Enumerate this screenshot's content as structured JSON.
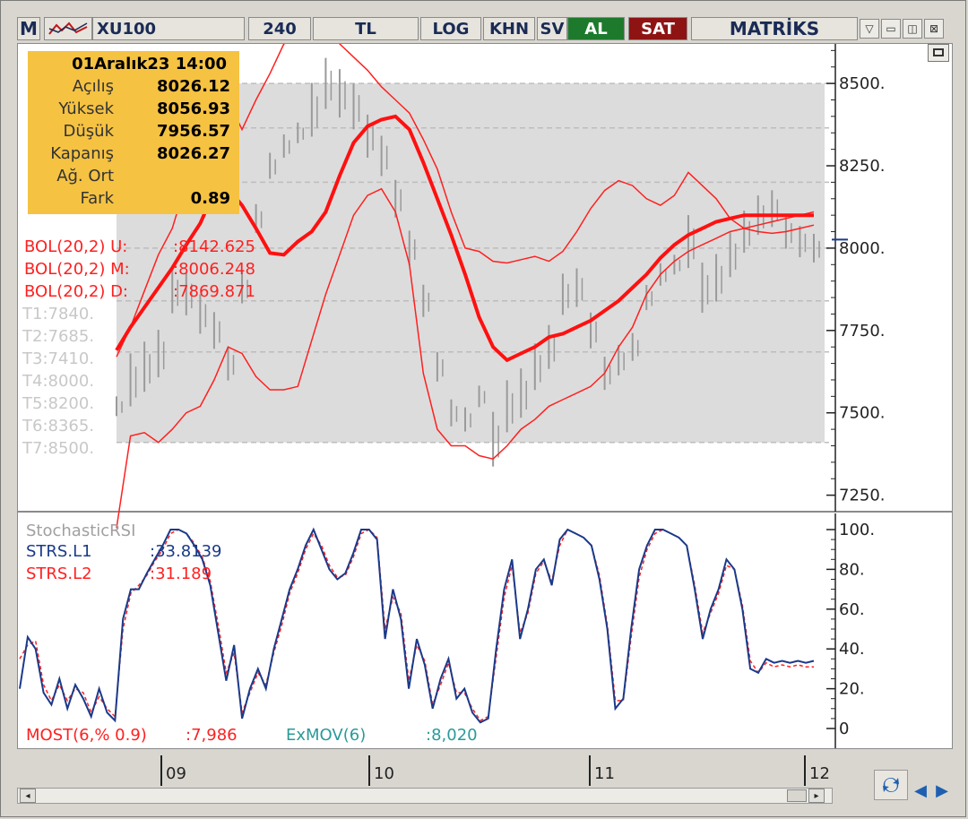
{
  "toolbar": {
    "logo": "M",
    "symbol": "XU100",
    "period": "240",
    "currency": "TL",
    "log": "LOG",
    "khn": "KHN",
    "sv": "SV",
    "buy": "AL",
    "sell": "SAT",
    "brand": "MATRİKS"
  },
  "window_buttons": [
    "▽",
    "▭",
    "◫",
    "⊠"
  ],
  "infobox": {
    "date": "01Aralık23 14:00",
    "rows": [
      {
        "label": "Açılış",
        "value": "8026.12"
      },
      {
        "label": "Yüksek",
        "value": "8056.93"
      },
      {
        "label": "Düşük",
        "value": "7956.57"
      },
      {
        "label": "Kapanış",
        "value": "8026.27"
      },
      {
        "label": "Ağ. Ort",
        "value": ""
      },
      {
        "label": "Fark",
        "value": "0.89"
      }
    ]
  },
  "price_legend": {
    "upper": {
      "label": "BOL(20,2) U:",
      "value": ":8142.625"
    },
    "middle": {
      "label": "BOL(20,2) M:",
      "value": ":8006.248"
    },
    "lower": {
      "label": "BOL(20,2) D:",
      "value": ":7869.871"
    },
    "targets": [
      "T1:7840.",
      "T2:7685.",
      "T3:7410.",
      "T4:8000.",
      "T5:8200.",
      "T6:8365.",
      "T7:8500."
    ]
  },
  "osc_legend": {
    "title": "StochasticRSI",
    "l1": {
      "label": "STRS.L1",
      "value": ":33.8139"
    },
    "l2": {
      "label": "STRS.L2",
      "value": ":31.189"
    },
    "most": {
      "label": "MOST(6,% 0.9)",
      "value": ":7,986"
    },
    "exmov": {
      "label": "ExMOV(6)",
      "value": ":8,020"
    }
  },
  "colors": {
    "bollinger": "#ff2020",
    "middle_band": "#ff1010",
    "candles": "#9a9a9a",
    "band_fill": "#dcdcdc",
    "l1": "#1a3a8a",
    "l2": "#ff2020",
    "exmov": "#2a9a9a",
    "info_bg": "#f5c242",
    "target_text": "#c8c8c8"
  },
  "chart_data": [
    {
      "type": "line",
      "title": "",
      "ylim": [
        7200,
        8620
      ],
      "y_ticks": [
        "8500.",
        "8250.",
        "8000.",
        "7750.",
        "7500.",
        "7250."
      ],
      "y_tick_values": [
        8500,
        8250,
        8000,
        7750,
        7500,
        7250
      ],
      "target_levels": [
        7840,
        7685,
        7410,
        8000,
        8200,
        8365,
        8500
      ],
      "x": [
        0,
        2,
        4,
        6,
        8,
        10,
        12,
        14,
        16,
        18,
        20,
        22,
        24,
        26,
        28,
        30,
        32,
        34,
        36,
        38,
        40,
        42,
        44,
        46,
        48,
        50,
        52,
        54,
        56,
        58,
        60,
        62,
        64,
        66,
        68,
        70,
        72,
        74,
        76,
        78,
        80,
        82,
        84,
        86,
        88,
        90,
        92,
        94,
        96,
        98,
        100
      ],
      "series": [
        {
          "name": "BOL(20,2) U",
          "values": [
            7670,
            7760,
            7870,
            7980,
            8060,
            8200,
            8330,
            8480,
            8450,
            8360,
            8450,
            8530,
            8620,
            8640,
            8680,
            8660,
            8620,
            8580,
            8540,
            8490,
            8450,
            8410,
            8330,
            8240,
            8110,
            8000,
            7990,
            7960,
            7955,
            7965,
            7975,
            7960,
            7990,
            8050,
            8120,
            8175,
            8205,
            8190,
            8150,
            8130,
            8160,
            8230,
            8190,
            8150,
            8090,
            8060,
            8050,
            8045,
            8050,
            8060,
            8070
          ]
        },
        {
          "name": "BOL(20,2) M",
          "values": [
            7690,
            7760,
            7820,
            7880,
            7940,
            8010,
            8075,
            8170,
            8180,
            8130,
            8060,
            7985,
            7980,
            8020,
            8050,
            8110,
            8220,
            8320,
            8370,
            8390,
            8400,
            8360,
            8260,
            8150,
            8040,
            7920,
            7790,
            7700,
            7660,
            7680,
            7700,
            7730,
            7740,
            7760,
            7780,
            7810,
            7840,
            7880,
            7920,
            7970,
            8010,
            8040,
            8060,
            8080,
            8090,
            8100,
            8100,
            8100,
            8100,
            8100,
            8100
          ]
        },
        {
          "name": "BOL(20,2) D",
          "values": [
            7150,
            7430,
            7440,
            7410,
            7450,
            7500,
            7520,
            7600,
            7700,
            7680,
            7610,
            7570,
            7570,
            7580,
            7720,
            7860,
            7980,
            8100,
            8160,
            8180,
            8110,
            7950,
            7620,
            7450,
            7400,
            7400,
            7370,
            7360,
            7400,
            7450,
            7480,
            7520,
            7540,
            7560,
            7580,
            7620,
            7700,
            7760,
            7860,
            7920,
            7960,
            7990,
            8010,
            8030,
            8050,
            8060,
            8070,
            8080,
            8090,
            8100,
            8110
          ]
        },
        {
          "name": "candles",
          "type": "candlestick",
          "values": [
            7520,
            7600,
            7640,
            7680,
            7870,
            7860,
            7800,
            7750,
            7650,
            7880,
            8090,
            8250,
            8310,
            8350,
            8420,
            8500,
            8470,
            8430,
            8340,
            8280,
            8150,
            8000,
            7840,
            7640,
            7500,
            7480,
            7550,
            7420,
            7520,
            7560,
            7640,
            7700,
            7860,
            7880,
            7750,
            7620,
            7660,
            7700,
            7850,
            7920,
            7950,
            8020,
            7880,
            7910,
            7980,
            8050,
            8100,
            8120,
            8050,
            8020,
            8000
          ]
        }
      ]
    },
    {
      "type": "line",
      "title": "StochasticRSI",
      "ylim": [
        0,
        100
      ],
      "y_ticks": [
        "100.",
        "80.",
        "60.",
        "40.",
        "20.",
        "0"
      ],
      "y_tick_values": [
        100,
        80,
        60,
        40,
        20,
        0
      ],
      "x_ticks": [
        "09",
        "10",
        "11",
        "12"
      ],
      "x": [
        0,
        1,
        2,
        3,
        4,
        5,
        6,
        7,
        8,
        9,
        10,
        11,
        12,
        13,
        14,
        15,
        16,
        17,
        18,
        19,
        20,
        21,
        22,
        23,
        24,
        25,
        26,
        27,
        28,
        29,
        30,
        31,
        32,
        33,
        34,
        35,
        36,
        37,
        38,
        39,
        40,
        41,
        42,
        43,
        44,
        45,
        46,
        47,
        48,
        49,
        50,
        51,
        52,
        53,
        54,
        55,
        56,
        57,
        58,
        59,
        60,
        61,
        62,
        63,
        64,
        65,
        66,
        67,
        68,
        69,
        70,
        71,
        72,
        73,
        74,
        75,
        76,
        77,
        78,
        79,
        80,
        81,
        82,
        83,
        84,
        85,
        86,
        87,
        88,
        89,
        90,
        91,
        92,
        93,
        94,
        95,
        96,
        97,
        98,
        99,
        100
      ],
      "series": [
        {
          "name": "STRS.L1",
          "values": [
            20,
            46,
            40,
            18,
            12,
            25,
            10,
            22,
            15,
            6,
            20,
            8,
            4,
            55,
            70,
            70,
            78,
            85,
            92,
            100,
            100,
            98,
            92,
            85,
            72,
            48,
            24,
            42,
            5,
            20,
            30,
            20,
            40,
            55,
            70,
            80,
            92,
            100,
            90,
            80,
            75,
            78,
            88,
            100,
            100,
            95,
            45,
            70,
            55,
            20,
            45,
            32,
            10,
            25,
            35,
            15,
            20,
            8,
            3,
            5,
            40,
            70,
            85,
            45,
            60,
            80,
            85,
            72,
            95,
            100,
            98,
            96,
            92,
            75,
            50,
            10,
            15,
            50,
            80,
            92,
            100,
            100,
            98,
            96,
            92,
            70,
            45,
            60,
            70,
            85,
            80,
            60,
            30,
            28,
            35,
            33,
            34,
            33,
            34,
            33,
            34
          ]
        },
        {
          "name": "STRS.L2",
          "values": [
            35,
            42,
            44,
            22,
            14,
            22,
            14,
            20,
            18,
            8,
            16,
            10,
            6,
            50,
            68,
            72,
            77,
            84,
            90,
            98,
            100,
            98,
            93,
            86,
            74,
            52,
            28,
            38,
            8,
            18,
            28,
            22,
            38,
            52,
            68,
            78,
            90,
            98,
            92,
            82,
            76,
            77,
            86,
            98,
            100,
            96,
            50,
            66,
            58,
            24,
            42,
            34,
            12,
            22,
            33,
            18,
            18,
            10,
            4,
            6,
            36,
            66,
            82,
            48,
            58,
            78,
            84,
            74,
            92,
            100,
            98,
            96,
            92,
            77,
            52,
            14,
            14,
            46,
            76,
            90,
            98,
            100,
            98,
            96,
            92,
            72,
            48,
            58,
            68,
            82,
            80,
            62,
            34,
            28,
            33,
            31,
            32,
            31,
            32,
            31,
            31
          ]
        }
      ]
    }
  ],
  "xaxis_ticks": [
    "09",
    "10",
    "11",
    "12"
  ]
}
